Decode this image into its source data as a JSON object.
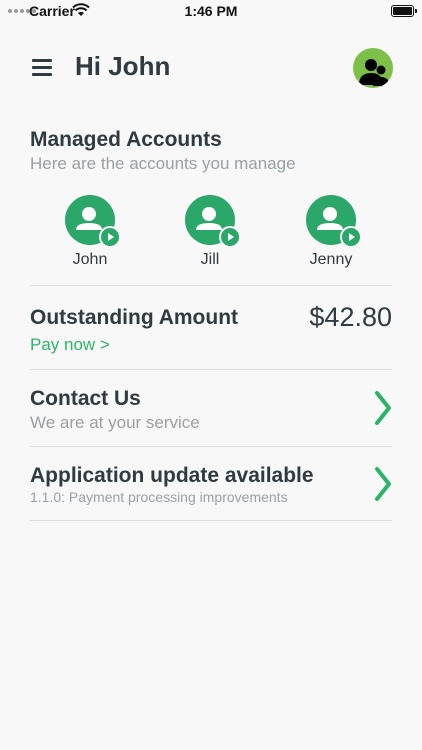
{
  "status_bar": {
    "carrier": "Carrier",
    "time": "1:46 PM"
  },
  "header": {
    "greeting": "Hi John"
  },
  "managed_accounts": {
    "title": "Managed Accounts",
    "subtitle": "Here are the accounts you manage",
    "accounts": [
      {
        "name": "John"
      },
      {
        "name": "Jill"
      },
      {
        "name": "Jenny"
      }
    ]
  },
  "outstanding": {
    "title": "Outstanding Amount",
    "amount": "$42.80",
    "pay_label": "Pay now >"
  },
  "contact": {
    "title": "Contact Us",
    "subtitle": "We are at your service"
  },
  "update": {
    "title": "Application update available",
    "subtitle": "1.1.0: Payment processing improvements"
  },
  "colors": {
    "accent": "#2aa769",
    "link": "#2ab566",
    "text": "#2f3b40",
    "muted": "#9aa0a3"
  }
}
